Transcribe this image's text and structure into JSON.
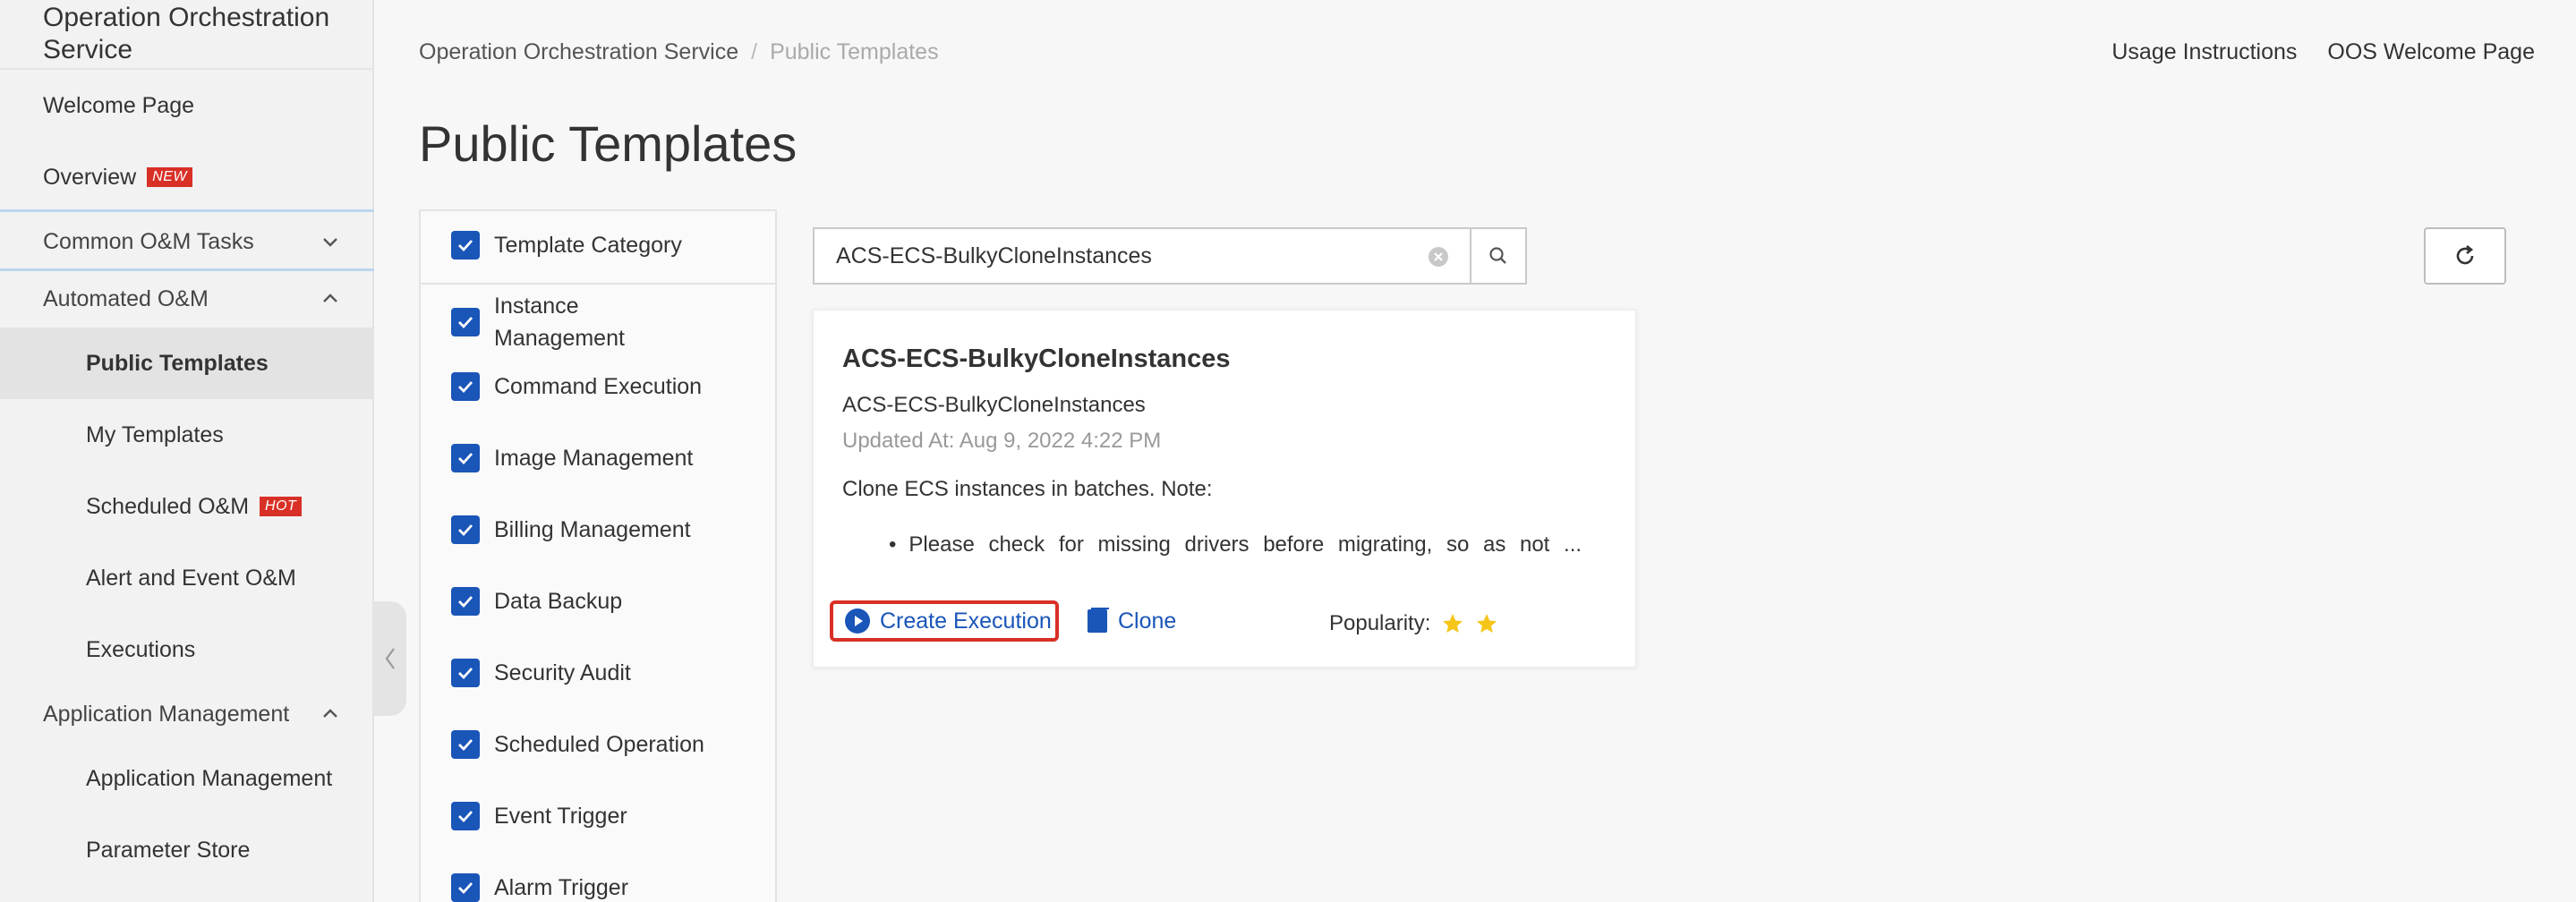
{
  "sidebar": {
    "title": "Operation Orchestration Service",
    "items": [
      {
        "label": "Welcome Page"
      },
      {
        "label": "Overview",
        "tag": "NEW"
      },
      {
        "label": "Common O&M Tasks"
      },
      {
        "label": "Automated O&M"
      },
      {
        "label": "Public Templates"
      },
      {
        "label": "My Templates"
      },
      {
        "label": "Scheduled O&M",
        "tag": "HOT"
      },
      {
        "label": "Alert and Event O&M"
      },
      {
        "label": "Executions"
      },
      {
        "label": "Application Management"
      },
      {
        "label": "Application Management"
      },
      {
        "label": "Parameter Store"
      }
    ]
  },
  "breadcrumb": {
    "root": "Operation Orchestration Service",
    "separator": "/",
    "current": "Public Templates"
  },
  "top_links": {
    "usage": "Usage Instructions",
    "welcome": "OOS Welcome Page"
  },
  "page_title": "Public Templates",
  "filter": {
    "header": "Template Category",
    "categories": [
      "Instance Management",
      "Command Execution",
      "Image Management",
      "Billing Management",
      "Data Backup",
      "Security Audit",
      "Scheduled Operation",
      "Event Trigger",
      "Alarm Trigger"
    ]
  },
  "search": {
    "value": "ACS-ECS-BulkyCloneInstances"
  },
  "card": {
    "title": "ACS-ECS-BulkyCloneInstances",
    "name": "ACS-ECS-BulkyCloneInstances",
    "updated": "Updated At: Aug 9, 2022 4:22 PM",
    "description": "Clone ECS instances in batches. Note:",
    "bullet": "Please check for missing drivers before migrating, so as not ...",
    "create_label": "Create Execution",
    "clone_label": "Clone",
    "popularity_label": "Popularity:",
    "popularity_stars": 2
  },
  "colors": {
    "accent": "#1a55b8",
    "tag_red": "#d93026",
    "star": "#f5c518"
  }
}
